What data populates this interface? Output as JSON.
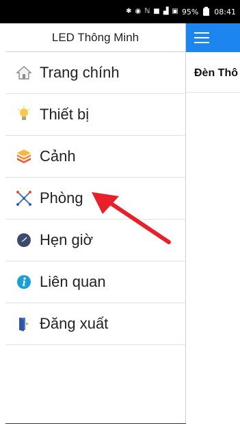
{
  "status_bar": {
    "icons": [
      "bluetooth-icon",
      "alarm-icon",
      "nfc-icon",
      "data-icon",
      "signal-icon",
      "sim-icon",
      "battery-icon"
    ],
    "battery": "95%",
    "time": "08:41"
  },
  "drawer": {
    "title": "LED Thông Minh",
    "items": [
      {
        "label": "Trang chính",
        "icon": "home-icon"
      },
      {
        "label": "Thiết bị",
        "icon": "lightbulb-icon"
      },
      {
        "label": "Cảnh",
        "icon": "layers-icon"
      },
      {
        "label": "Phòng",
        "icon": "network-icon"
      },
      {
        "label": "Hẹn giờ",
        "icon": "clock-icon"
      },
      {
        "label": "Liên quan",
        "icon": "info-icon"
      },
      {
        "label": "Đăng xuất",
        "icon": "logout-icon"
      }
    ]
  },
  "main": {
    "title": "Đèn Thô"
  },
  "colors": {
    "appbar": "#1c86ee",
    "arrow": "#e8202a",
    "info": "#1a9fd6"
  }
}
